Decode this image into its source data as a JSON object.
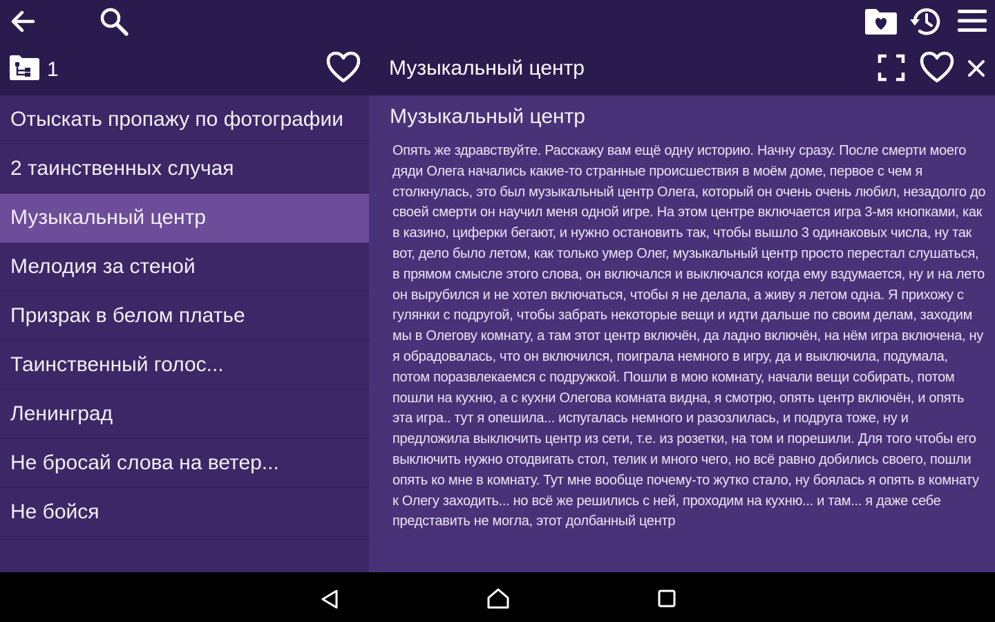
{
  "toolbar": {
    "back_icon": "arrow-left-icon",
    "search_icon": "search-icon",
    "favorites_folder_icon": "folder-heart-icon",
    "history_icon": "history-icon",
    "menu_icon": "hamburger-menu-icon"
  },
  "list_header": {
    "tree_icon": "tree-structure-icon",
    "count": "1",
    "favorite_icon": "heart-outline-icon"
  },
  "detail_header": {
    "title": "Музыкальный центр",
    "fullscreen_icon": "fullscreen-icon",
    "favorite_icon": "heart-outline-icon",
    "close_icon": "close-icon"
  },
  "stories": [
    {
      "title": "Отыскать пропажу по фотографии",
      "selected": false
    },
    {
      "title": "2 таинственных случая",
      "selected": false
    },
    {
      "title": "Музыкальный центр",
      "selected": true
    },
    {
      "title": "Мелодия за стеной",
      "selected": false
    },
    {
      "title": "Призрак в белом платье",
      "selected": false
    },
    {
      "title": "Таинственный голос...",
      "selected": false
    },
    {
      "title": "Ленинград",
      "selected": false
    },
    {
      "title": "Не бросай слова на ветер...",
      "selected": false
    },
    {
      "title": "Не бойся",
      "selected": false
    }
  ],
  "article": {
    "title": "Музыкальный центр",
    "body": "Опять же здравствуйте. Расскажу вам ещё одну историю. Начну сразу. После смерти моего дяди Олега начались какие-то странные происшествия в моём доме, первое с чем я столкнулась, это был музыкальный центр Олега, который он очень очень любил, незадолго до своей смерти он научил меня одной игре. На этом центре включается игра 3-мя кнопками, как в казино, циферки бегают, и нужно остановить так, чтобы вышло 3 одинаковых числа, ну так вот, дело было летом, как только умер Олег, музыкальный центр просто перестал слушаться, в прямом смысле этого слова, он включался и выключался когда ему вздумается, ну и на лето он вырубился и не хотел включаться, чтобы я не делала, а живу я летом одна. Я прихожу с гулянки с подругой, чтобы забрать некоторые вещи и идти дальше по своим делам, заходим мы в Олегову комнату, а там этот центр включён, да ладно включён, на нём игра включена, ну я обрадовалась, что он включился, поиграла немного в игру, да и выключила, подумала, потом поразвлекаемся с подружкой. Пошли в мою комнату, начали вещи собирать, потом пошли на кухню, а с кухни Олегова комната видна, я смотрю, опять центр включён, и опять эта игра.. тут я опешила... испугалась немного и разозлилась, и подруга тоже, ну и предложила выключить центр из сети, т.е. из розетки, на том и порешили. Для того чтобы его выключить нужно отодвигать стол, телик и много чего, но всё равно добились своего, пошли опять ко мне в комнату. Тут мне вообще почему-то жутко стало, ну боялась я опять в комнату к Олегу заходить... но всё же решились с ней, проходим на кухню... и там... я даже себе представить не могла, этот долбанный центр"
  },
  "system_nav": {
    "back_icon": "nav-back-icon",
    "home_icon": "nav-home-icon",
    "recents_icon": "nav-recents-icon"
  }
}
